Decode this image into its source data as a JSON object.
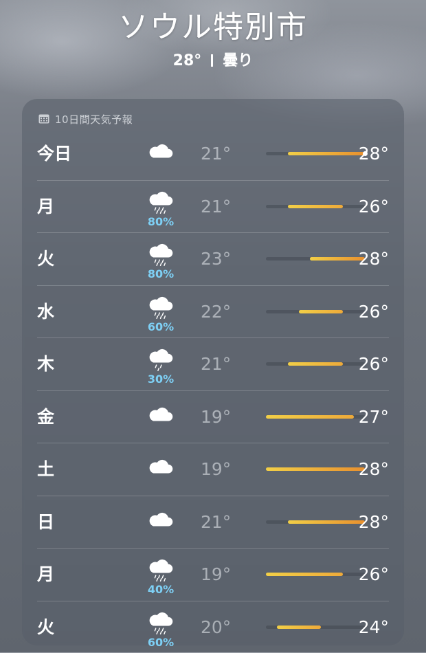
{
  "location": {
    "city": "ソウル特別市",
    "current_temp": "28°",
    "condition": "曇り"
  },
  "forecast": {
    "title": "10日間天気予報",
    "range_min": 19,
    "range_max": 28,
    "current_temp_value": 28,
    "days": [
      {
        "day": "今日",
        "icon": "cloud-icon",
        "precip": "",
        "low": "21°",
        "high": "28°",
        "low_v": 21,
        "high_v": 28,
        "show_current": true
      },
      {
        "day": "月",
        "icon": "cloud-rain-icon",
        "precip": "80%",
        "low": "21°",
        "high": "26°",
        "low_v": 21,
        "high_v": 26
      },
      {
        "day": "火",
        "icon": "cloud-rain-icon",
        "precip": "80%",
        "low": "23°",
        "high": "28°",
        "low_v": 23,
        "high_v": 28
      },
      {
        "day": "水",
        "icon": "cloud-rain-icon",
        "precip": "60%",
        "low": "22°",
        "high": "26°",
        "low_v": 22,
        "high_v": 26
      },
      {
        "day": "木",
        "icon": "cloud-drizzle-icon",
        "precip": "30%",
        "low": "21°",
        "high": "26°",
        "low_v": 21,
        "high_v": 26
      },
      {
        "day": "金",
        "icon": "cloud-icon",
        "precip": "",
        "low": "19°",
        "high": "27°",
        "low_v": 19,
        "high_v": 27
      },
      {
        "day": "土",
        "icon": "cloud-icon",
        "precip": "",
        "low": "19°",
        "high": "28°",
        "low_v": 19,
        "high_v": 28
      },
      {
        "day": "日",
        "icon": "cloud-icon",
        "precip": "",
        "low": "21°",
        "high": "28°",
        "low_v": 21,
        "high_v": 28
      },
      {
        "day": "月",
        "icon": "cloud-rain-icon",
        "precip": "40%",
        "low": "19°",
        "high": "26°",
        "low_v": 19,
        "high_v": 26
      },
      {
        "day": "火",
        "icon": "cloud-rain-icon",
        "precip": "60%",
        "low": "20°",
        "high": "24°",
        "low_v": 20,
        "high_v": 24
      }
    ]
  },
  "colors": {
    "bar_cool": "#f2cf47",
    "bar_warm": "#e8902e",
    "precip_text": "#7ed0f5"
  }
}
